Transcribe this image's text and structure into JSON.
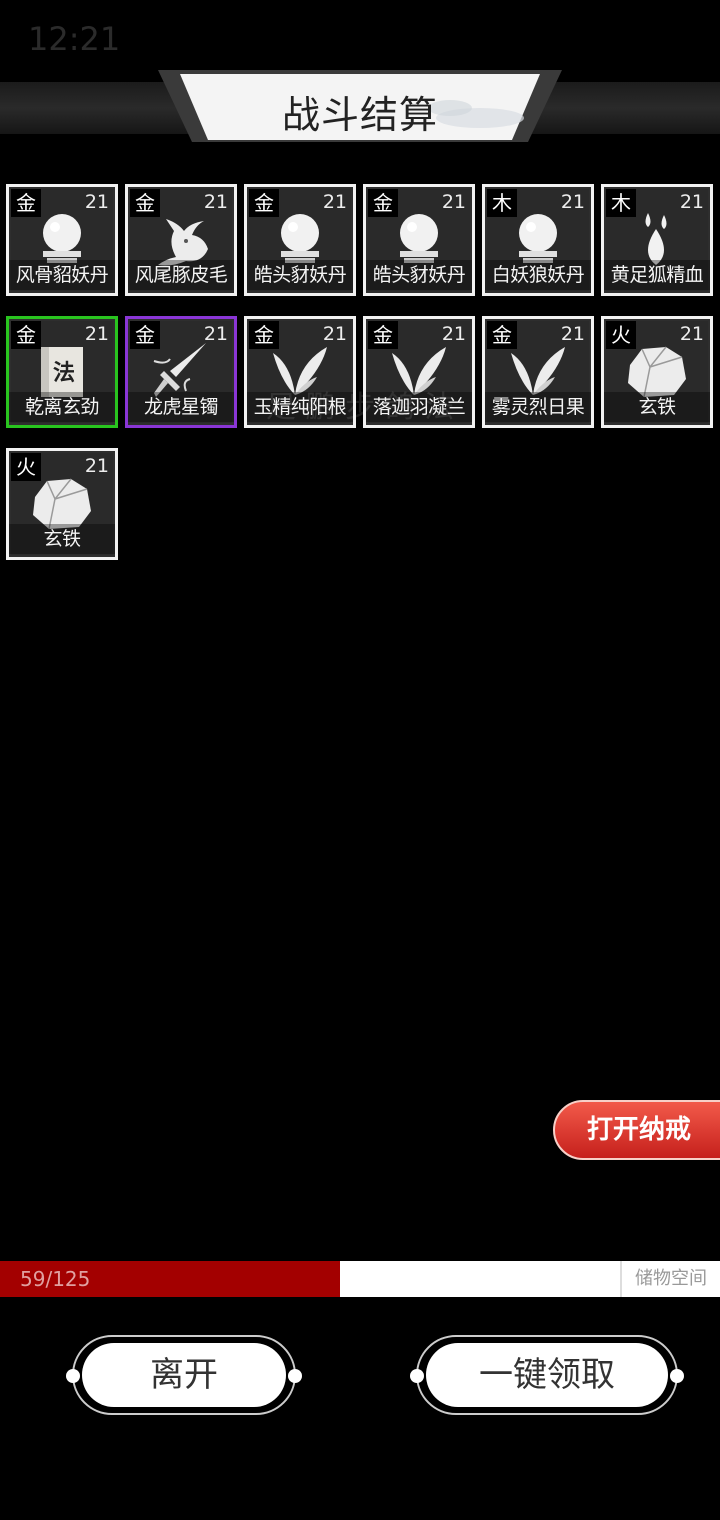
{
  "status": {
    "time": "12:21"
  },
  "title": "战斗结算",
  "watermark": "足 鹏 步 鸽 法",
  "items": [
    {
      "element": "金",
      "level": "21",
      "name": "风骨貂妖丹",
      "icon": "orb-icon",
      "rarity": "white"
    },
    {
      "element": "金",
      "level": "21",
      "name": "风尾豚皮毛",
      "icon": "fur-icon",
      "rarity": "white"
    },
    {
      "element": "金",
      "level": "21",
      "name": "皓头豺妖丹",
      "icon": "orb-icon",
      "rarity": "white"
    },
    {
      "element": "金",
      "level": "21",
      "name": "皓头豺妖丹",
      "icon": "orb-icon",
      "rarity": "white"
    },
    {
      "element": "木",
      "level": "21",
      "name": "白妖狼妖丹",
      "icon": "orb-icon",
      "rarity": "white"
    },
    {
      "element": "木",
      "level": "21",
      "name": "黄足狐精血",
      "icon": "blood-drops-icon",
      "rarity": "white"
    },
    {
      "element": "金",
      "level": "21",
      "name": "乾离玄劲",
      "icon": "scroll-icon",
      "rarity": "green",
      "scroll_glyph": "法"
    },
    {
      "element": "金",
      "level": "21",
      "name": "龙虎星镯",
      "icon": "sword-icon",
      "rarity": "purple"
    },
    {
      "element": "金",
      "level": "21",
      "name": "玉精纯阳根",
      "icon": "leaf-icon",
      "rarity": "white"
    },
    {
      "element": "金",
      "level": "21",
      "name": "落迦羽凝兰",
      "icon": "leaf-icon",
      "rarity": "white"
    },
    {
      "element": "金",
      "level": "21",
      "name": "雾灵烈日果",
      "icon": "leaf-icon",
      "rarity": "white"
    },
    {
      "element": "火",
      "level": "21",
      "name": "玄铁",
      "icon": "ore-icon",
      "rarity": "white"
    },
    {
      "element": "火",
      "level": "21",
      "name": "玄铁",
      "icon": "ore-icon",
      "rarity": "white"
    }
  ],
  "open_ring_button": "打开纳戒",
  "storage": {
    "count": "59/125",
    "label": "储物空间",
    "fill_fraction": 0.472
  },
  "buttons": {
    "leave": "离开",
    "claim_all": "一键领取"
  },
  "colors": {
    "green": "#29c41f",
    "purple": "#8a36d6",
    "storage_fill": "#a30000",
    "accent_red": "#d32a22"
  }
}
